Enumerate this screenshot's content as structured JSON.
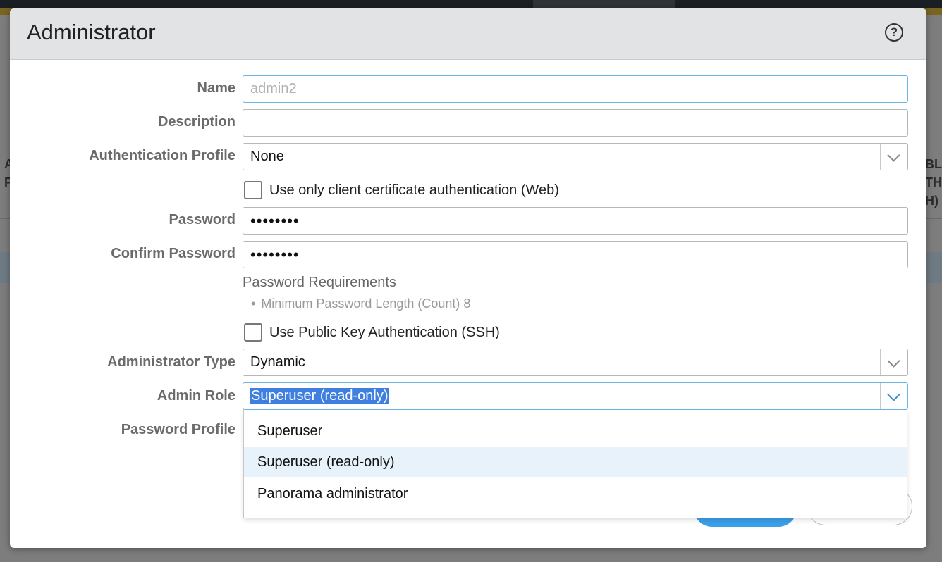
{
  "dialog": {
    "title": "Administrator",
    "help_icon": "question-circle-icon",
    "help_glyph": "?"
  },
  "form": {
    "name_label": "Name",
    "name_placeholder": "admin2",
    "description_label": "Description",
    "description_value": "",
    "auth_profile_label": "Authentication Profile",
    "auth_profile_value": "None",
    "client_cert_label": "Use only client certificate authentication (Web)",
    "client_cert_checked": false,
    "password_label": "Password",
    "password_value": "••••••••",
    "confirm_password_label": "Confirm Password",
    "confirm_password_value": "••••••••",
    "password_requirements_title": "Password Requirements",
    "password_requirements_item": "Minimum Password Length (Count) 8",
    "public_key_label": "Use Public Key Authentication (SSH)",
    "public_key_checked": false,
    "admin_type_label": "Administrator Type",
    "admin_type_value": "Dynamic",
    "admin_role_label": "Admin Role",
    "admin_role_value": "Superuser (read-only)",
    "password_profile_label": "Password Profile"
  },
  "admin_role_options": {
    "opt1": "Superuser",
    "opt2": "Superuser (read-only)",
    "opt3": "Panorama administrator",
    "highlighted": "Superuser (read-only)"
  },
  "background": {
    "right_fragment": "BLI\nTH\nH)",
    "left_fragment": "A\nP"
  },
  "colors": {
    "accent_blue": "#3aa0e8",
    "focus_border": "#6bb6e6",
    "selection": "#3f7fe0",
    "highlight_row": "#e8f2fa"
  }
}
